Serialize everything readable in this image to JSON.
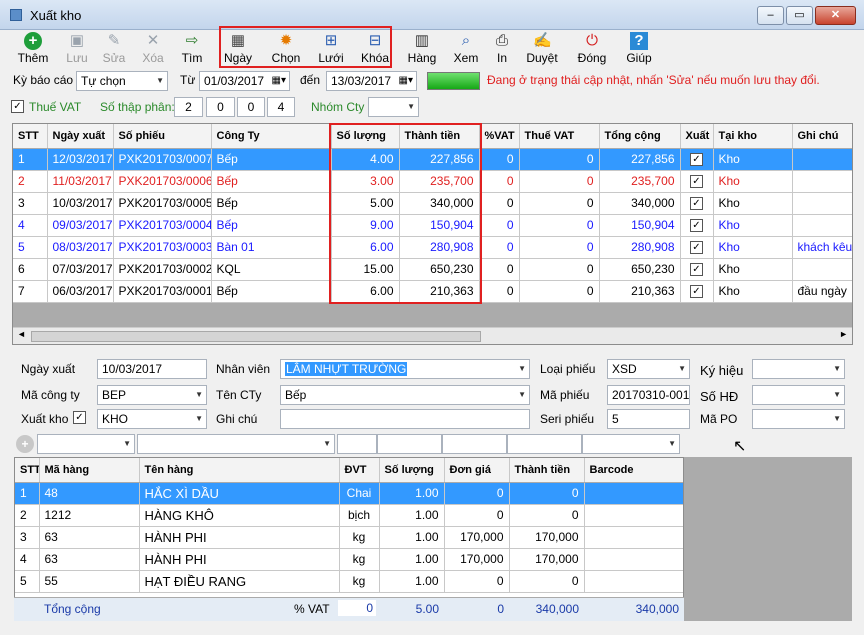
{
  "window": {
    "title": "Xuất kho",
    "icon": "app-icon"
  },
  "toolbar": [
    {
      "key": "them",
      "label": "Thêm",
      "icon": "plus-circle-icon",
      "glyph": "+",
      "color": "#1e9e3a",
      "enabled": true
    },
    {
      "key": "luu",
      "label": "Lưu",
      "icon": "save-icon",
      "glyph": "▣",
      "color": "#9aa3ad",
      "enabled": false
    },
    {
      "key": "sua",
      "label": "Sửa",
      "icon": "pencil-icon",
      "glyph": "✎",
      "color": "#9aa3ad",
      "enabled": false
    },
    {
      "key": "xoa",
      "label": "Xóa",
      "icon": "delete-x-icon",
      "glyph": "✕",
      "color": "#9aa3ad",
      "enabled": false
    },
    {
      "key": "tim",
      "label": "Tìm",
      "icon": "find-icon",
      "glyph": "⇨",
      "color": "#2b7a2b",
      "enabled": true
    },
    {
      "key": "ngay",
      "label": "Ngày",
      "icon": "calendar-icon",
      "glyph": "▦",
      "color": "#444",
      "enabled": true
    },
    {
      "key": "chon",
      "label": "Chọn",
      "icon": "gear-icon",
      "glyph": "✹",
      "color": "#e67a00",
      "enabled": true
    },
    {
      "key": "luoi",
      "label": "Lưới",
      "icon": "grid-icon",
      "glyph": "⊞",
      "color": "#2a5db0",
      "enabled": true
    },
    {
      "key": "khoa",
      "label": "Khóa",
      "icon": "lock-icon",
      "glyph": "⊟",
      "color": "#2a5db0",
      "enabled": true
    },
    {
      "key": "hang",
      "label": "Hàng",
      "icon": "books-icon",
      "glyph": "▥",
      "color": "#333",
      "enabled": true
    },
    {
      "key": "xem",
      "label": "Xem",
      "icon": "preview-icon",
      "glyph": "⌕",
      "color": "#2a5db0",
      "enabled": true
    },
    {
      "key": "in",
      "label": "In",
      "icon": "printer-icon",
      "glyph": "⎙",
      "color": "#222",
      "enabled": true
    },
    {
      "key": "duyet",
      "label": "Duyệt",
      "icon": "approve-icon",
      "glyph": "✍",
      "color": "#b06a1a",
      "enabled": true
    },
    {
      "key": "dong",
      "label": "Đóng",
      "icon": "power-icon",
      "glyph": "⏻",
      "color": "#d42020",
      "enabled": true
    },
    {
      "key": "giup",
      "label": "Giúp",
      "icon": "help-icon",
      "glyph": "?",
      "color": "#2a8ad6",
      "enabled": true
    }
  ],
  "filter": {
    "ky_bao_cao_label": "Kỳ báo cáo",
    "ky_bao_cao_value": "Tự chọn",
    "tu_label": "Từ",
    "tu_value": "01/03/2017",
    "den_label": "đến",
    "den_value": "13/03/2017",
    "status_message": "Đang ở trạng thái cập nhật, nhấn 'Sửa' nếu muốn lưu thay đổi.",
    "thue_vat_label": "Thuế VAT",
    "thue_vat_checked": "✓",
    "so_thap_phan_label": "Số thập phân:",
    "so_thap_phan_values": [
      "2",
      "0",
      "0",
      "4"
    ],
    "nhom_cty_label": "Nhóm Cty",
    "nhom_cty_value": ""
  },
  "master_grid": {
    "headers": [
      "STT",
      "Ngày xuất",
      "Số phiếu",
      "Công Ty",
      "Số lượng",
      "Thành tiền",
      "%VAT",
      "Thuế VAT",
      "Tổng cộng",
      "Xuất",
      "Tại kho",
      "Ghi chú"
    ],
    "rows": [
      {
        "stt": "1",
        "ngay": "12/03/2017",
        "so_phieu": "PXK201703/0007",
        "cong_ty": "Bếp",
        "so_luong": "4.00",
        "thanh_tien": "227,856",
        "vat_pct": "0",
        "thue_vat": "0",
        "tong_cong": "227,856",
        "xuat": "✓",
        "tai_kho": "Kho",
        "ghi_chu": "",
        "style": "sel"
      },
      {
        "stt": "2",
        "ngay": "11/03/2017",
        "so_phieu": "PXK201703/0006",
        "cong_ty": "Bếp",
        "so_luong": "3.00",
        "thanh_tien": "235,700",
        "vat_pct": "0",
        "thue_vat": "0",
        "tong_cong": "235,700",
        "xuat": "✓",
        "tai_kho": "Kho",
        "ghi_chu": "",
        "style": "red"
      },
      {
        "stt": "3",
        "ngay": "10/03/2017",
        "so_phieu": "PXK201703/0005",
        "cong_ty": "Bếp",
        "so_luong": "5.00",
        "thanh_tien": "340,000",
        "vat_pct": "0",
        "thue_vat": "0",
        "tong_cong": "340,000",
        "xuat": "✓",
        "tai_kho": "Kho",
        "ghi_chu": "",
        "style": ""
      },
      {
        "stt": "4",
        "ngay": "09/03/2017",
        "so_phieu": "PXK201703/0004",
        "cong_ty": "Bếp",
        "so_luong": "9.00",
        "thanh_tien": "150,904",
        "vat_pct": "0",
        "thue_vat": "0",
        "tong_cong": "150,904",
        "xuat": "✓",
        "tai_kho": "Kho",
        "ghi_chu": "",
        "style": "blue"
      },
      {
        "stt": "5",
        "ngay": "08/03/2017",
        "so_phieu": "PXK201703/0003",
        "cong_ty": "Bàn 01",
        "so_luong": "6.00",
        "thanh_tien": "280,908",
        "vat_pct": "0",
        "thue_vat": "0",
        "tong_cong": "280,908",
        "xuat": "✓",
        "tai_kho": "Kho",
        "ghi_chu": "khách kêu",
        "style": "blue"
      },
      {
        "stt": "6",
        "ngay": "07/03/2017",
        "so_phieu": "PXK201703/0002",
        "cong_ty": "KQL",
        "so_luong": "15.00",
        "thanh_tien": "650,230",
        "vat_pct": "0",
        "thue_vat": "0",
        "tong_cong": "650,230",
        "xuat": "✓",
        "tai_kho": "Kho",
        "ghi_chu": "",
        "style": ""
      },
      {
        "stt": "7",
        "ngay": "06/03/2017",
        "so_phieu": "PXK201703/0001",
        "cong_ty": "Bếp",
        "so_luong": "6.00",
        "thanh_tien": "210,363",
        "vat_pct": "0",
        "thue_vat": "0",
        "tong_cong": "210,363",
        "xuat": "✓",
        "tai_kho": "Kho",
        "ghi_chu": "đầu ngày",
        "style": ""
      }
    ]
  },
  "detail": {
    "ngay_xuat_label": "Ngày xuất",
    "ngay_xuat_value": "10/03/2017",
    "nhan_vien_label": "Nhân viên",
    "nhan_vien_value": "LÂM NHỰT TRƯỜNG",
    "loai_phieu_label": "Loại phiếu",
    "loai_phieu_value": "XSD",
    "ky_hieu_label": "Ký hiệu",
    "ky_hieu_value": "",
    "ma_cong_ty_label": "Mã công ty",
    "ma_cong_ty_value": "BEP",
    "ten_cty_label": "Tên CTy",
    "ten_cty_value": "Bếp",
    "ma_phieu_label": "Mã phiếu",
    "ma_phieu_value": "20170310-001",
    "so_hd_label": "Số HĐ",
    "so_hd_value": "",
    "xuat_kho_label": "Xuất kho",
    "xuat_kho_checked": "✓",
    "kho_value": "KHO",
    "ghi_chu_label": "Ghi chú",
    "ghi_chu_value": "",
    "seri_phieu_label": "Seri phiếu",
    "seri_phieu_value": "5",
    "ma_po_label": "Mã PO",
    "ma_po_value": ""
  },
  "item_grid": {
    "headers": [
      "STT",
      "Mã hàng",
      "Tên hàng",
      "ĐVT",
      "Số lượng",
      "Đơn giá",
      "Thành tiền",
      "Barcode"
    ],
    "rows": [
      {
        "stt": "1",
        "ma": "48",
        "ten": "HẮC XÌ DẦU",
        "dvt": "Chai",
        "sl": "1.00",
        "don_gia": "0",
        "thanh_tien": "0",
        "barcode": "",
        "style": "sel"
      },
      {
        "stt": "2",
        "ma": "1212",
        "ten": "HÀNG KHÔ",
        "dvt": "bịch",
        "sl": "1.00",
        "don_gia": "0",
        "thanh_tien": "0",
        "barcode": "",
        "style": ""
      },
      {
        "stt": "3",
        "ma": "63",
        "ten": "HÀNH PHI",
        "dvt": "kg",
        "sl": "1.00",
        "don_gia": "170,000",
        "thanh_tien": "170,000",
        "barcode": "",
        "style": ""
      },
      {
        "stt": "4",
        "ma": "63",
        "ten": "HÀNH PHI",
        "dvt": "kg",
        "sl": "1.00",
        "don_gia": "170,000",
        "thanh_tien": "170,000",
        "barcode": "",
        "style": ""
      },
      {
        "stt": "5",
        "ma": "55",
        "ten": "HẠT ĐIỀU RANG",
        "dvt": "kg",
        "sl": "1.00",
        "don_gia": "0",
        "thanh_tien": "0",
        "barcode": "",
        "style": ""
      }
    ],
    "footer": {
      "label": "Tổng cộng",
      "vat_label": "% VAT",
      "vat_value": "0",
      "total_qty": "5.00",
      "thue": "0",
      "thanh_tien": "340,000",
      "tong": "340,000"
    }
  },
  "colors": {
    "selection": "#3399ff",
    "highlight_box": "#e02020",
    "status_red": "#e02020",
    "row_blue": "#1a1aff",
    "progress_green": "#22bb22"
  }
}
